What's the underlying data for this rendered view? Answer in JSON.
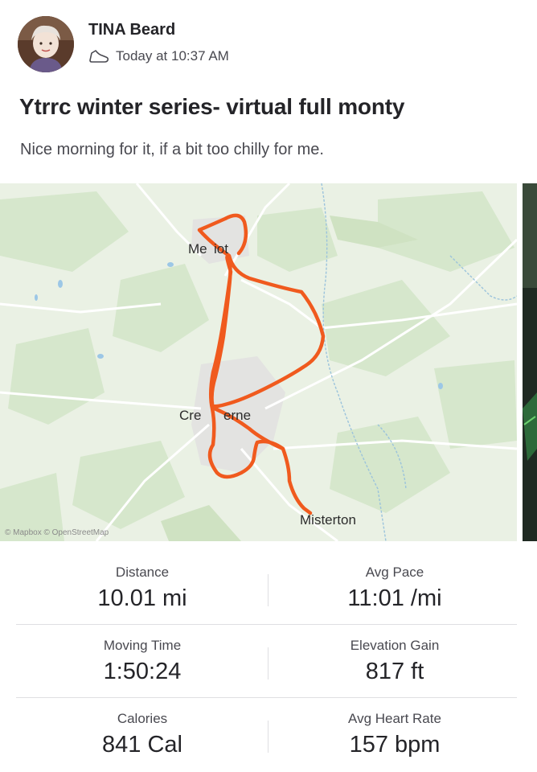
{
  "post": {
    "athlete_name": "TINA Beard",
    "timestamp": "Today at 10:37 AM",
    "activity_icon": "running-shoe-icon",
    "title": "Ytrrc winter series- virtual full monty",
    "description": "Nice morning for it, if a bit too chilly for me."
  },
  "map": {
    "places": [
      "Merriott",
      "Crewkerne",
      "Misterton"
    ],
    "place_labels_shown": {
      "merriott": "Me​ iot",
      "crewkerne": "Cre kerne",
      "misterton": "Misterton"
    },
    "attribution": "© Mapbox © OpenStreetMap",
    "route_color": "#f05a1e"
  },
  "stats": [
    {
      "label": "Distance",
      "value": "10.01 mi"
    },
    {
      "label": "Avg Pace",
      "value": "11:01 /mi"
    },
    {
      "label": "Moving Time",
      "value": "1:50:24"
    },
    {
      "label": "Elevation Gain",
      "value": "817 ft"
    },
    {
      "label": "Calories",
      "value": "841 Cal"
    },
    {
      "label": "Avg Heart Rate",
      "value": "157 bpm"
    }
  ]
}
